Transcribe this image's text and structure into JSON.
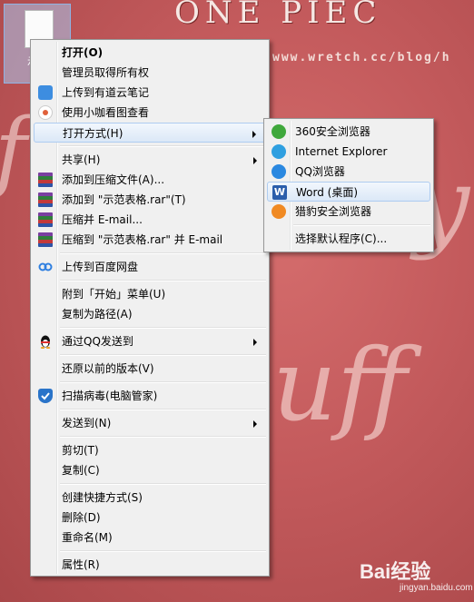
{
  "wallpaper": {
    "title": "ONE PIEC",
    "url": "www.wretch.cc/blog/h",
    "script_a": "f",
    "script_b": "y",
    "script_c": "uff",
    "watermark": "Bai经验",
    "watermark_sub": "jingyan.baidu.com"
  },
  "desktop_file": {
    "label": "示范"
  },
  "context_menu": {
    "items": [
      {
        "label": "打开(O)"
      },
      {
        "label": "管理员取得所有权"
      },
      {
        "label": "上传到有道云笔记"
      },
      {
        "label": "使用小咖看图查看"
      },
      {
        "label": "打开方式(H)"
      },
      {
        "label": "共享(H)"
      },
      {
        "label": "添加到压缩文件(A)..."
      },
      {
        "label": "添加到 \"示范表格.rar\"(T)"
      },
      {
        "label": "压缩并 E-mail..."
      },
      {
        "label": "压缩到 \"示范表格.rar\" 并 E-mail"
      },
      {
        "label": "上传到百度网盘"
      },
      {
        "label": "附到「开始」菜单(U)"
      },
      {
        "label": "复制为路径(A)"
      },
      {
        "label": "通过QQ发送到"
      },
      {
        "label": "还原以前的版本(V)"
      },
      {
        "label": "扫描病毒(电脑管家)"
      },
      {
        "label": "发送到(N)"
      },
      {
        "label": "剪切(T)"
      },
      {
        "label": "复制(C)"
      },
      {
        "label": "创建快捷方式(S)"
      },
      {
        "label": "删除(D)"
      },
      {
        "label": "重命名(M)"
      },
      {
        "label": "属性(R)"
      }
    ]
  },
  "open_with_menu": {
    "items": [
      {
        "label": "360安全浏览器"
      },
      {
        "label": "Internet Explorer"
      },
      {
        "label": "QQ浏览器"
      },
      {
        "label": "Word (桌面)"
      },
      {
        "label": "猎豹安全浏览器"
      },
      {
        "label": "选择默认程序(C)..."
      }
    ]
  },
  "icons": {
    "youdao": "cloud-note-icon",
    "kacha": "image-viewer-icon",
    "rar": "winrar-icon",
    "baidu": "baidu-netdisk-icon",
    "qq": "qq-penguin-icon",
    "guanjia": "shield-icon",
    "browser360": "browser-360-icon",
    "ie": "internet-explorer-icon",
    "qqbrowser": "qq-browser-icon",
    "word": "word-icon",
    "cheetah": "cheetah-browser-icon"
  },
  "colors": {
    "menu_bg": "#f0f0f0",
    "highlight_border": "#aeccf0",
    "wallpaper": "#c35a5c"
  }
}
